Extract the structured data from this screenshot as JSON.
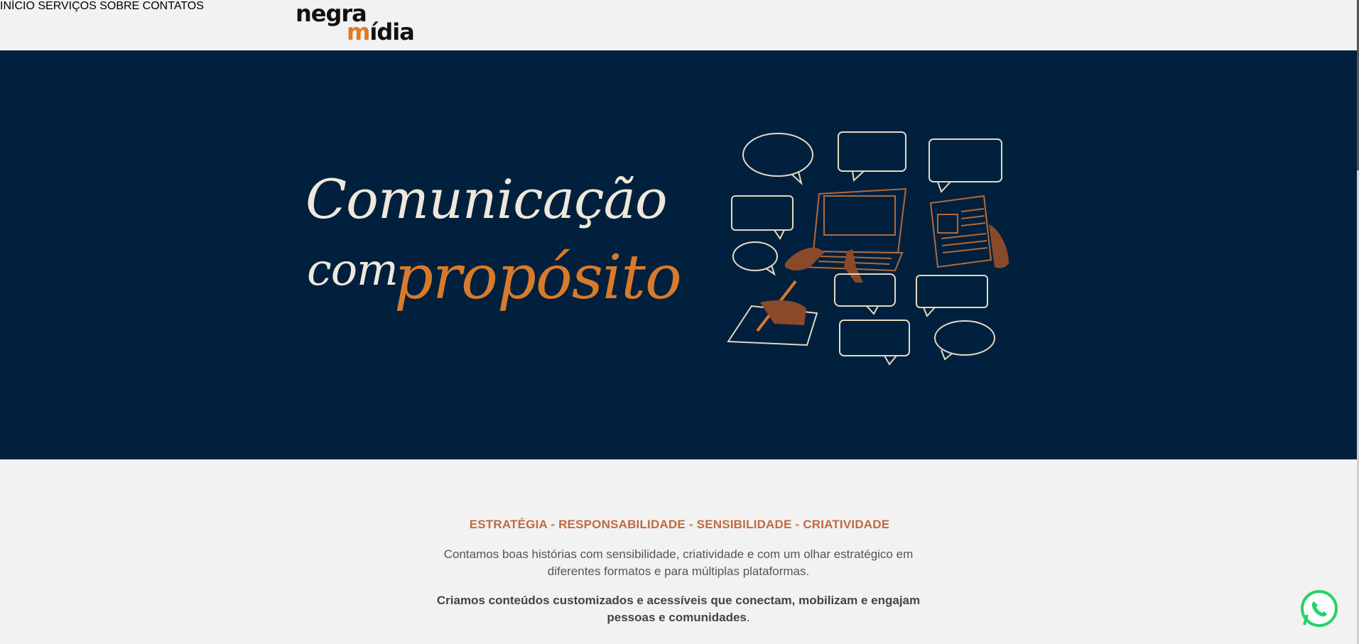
{
  "header": {
    "logo_line1": "negra",
    "logo_line2_prefix": "",
    "logo_line2_m": "m",
    "logo_line2_rest": "ídia",
    "nav": [
      {
        "label": "INÍCIO"
      },
      {
        "label": "SERVIÇOS"
      },
      {
        "label": "SOBRE"
      },
      {
        "label": "CONTATOS"
      }
    ]
  },
  "hero": {
    "title_line1": "Comunicação",
    "title_line2a": "com",
    "title_line2b": "propósito"
  },
  "content": {
    "tagline": "ESTRATÉGIA - RESPONSABILIDADE - SENSIBILIDADE - CRIATIVIDADE",
    "paragraph1": "Contamos boas histórias com sensibilidade, criatividade e com um olhar estratégico em diferentes formatos e para múltiplas plataformas.",
    "paragraph2_bold": "Criamos conteúdos customizados e acessíveis que conectam, mobilizam e engajam pessoas e comunidades",
    "paragraph2_end": "."
  },
  "colors": {
    "hero_bg": "#00203e",
    "accent": "#d97a2b",
    "tagline": "#c26a3e",
    "whatsapp": "#25d366"
  },
  "icons": [
    "whatsapp-icon",
    "speech-bubble-icon",
    "laptop-icon",
    "newspaper-icon",
    "writing-hand-icon"
  ]
}
